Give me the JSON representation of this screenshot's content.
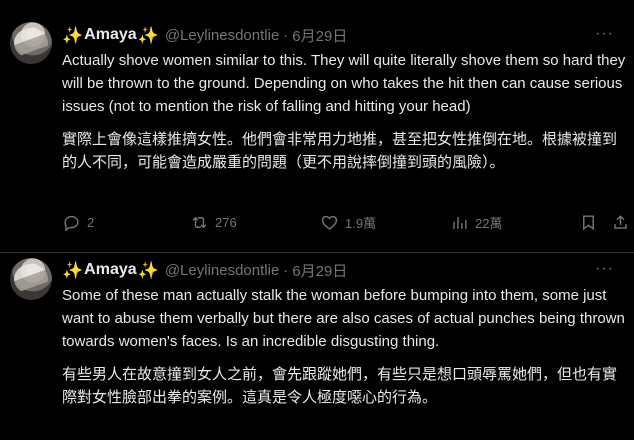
{
  "tweets": [
    {
      "author": {
        "emoji_left": "✨",
        "name": "Amaya",
        "emoji_right": "✨",
        "handle": "@Leylinesdontlie",
        "separator": "·",
        "date": "6月29日"
      },
      "more_label": "···",
      "text": "Actually shove women similar to this. They will quite literally shove them so hard they will be thrown to the ground. Depending on who takes the hit then can cause serious issues (not to mention the risk of falling and hitting your head)",
      "translation": "實際上會像這樣推擠女性。他們會非常用力地推，甚至把女性推倒在地。根據被撞到的人不同，可能會造成嚴重的問題（更不用說摔倒撞到頭的風險）。",
      "stats": {
        "replies": "2",
        "reposts": "276",
        "likes": "1.9萬",
        "views": "22萬"
      }
    },
    {
      "author": {
        "emoji_left": "✨",
        "name": "Amaya",
        "emoji_right": "✨",
        "handle": "@Leylinesdontlie",
        "separator": "·",
        "date": "6月29日"
      },
      "more_label": "···",
      "text": "Some of these man actually stalk the woman before bumping into them, some just want to abuse them verbally but there are also cases of actual punches being thrown towards women's faces. Is an incredible disgusting thing.",
      "translation": "有些男人在故意撞到女人之前，會先跟蹤她們，有些只是想口頭辱罵她們，但也有實際對女性臉部出拳的案例。這真是令人極度噁心的行為。"
    }
  ],
  "colors": {
    "background": "#000000",
    "text": "#e7e9ea",
    "muted": "#71767b",
    "divider": "#2f3336"
  },
  "icons": [
    "reply-icon",
    "repost-icon",
    "like-icon",
    "views-icon",
    "bookmark-icon",
    "share-icon"
  ]
}
